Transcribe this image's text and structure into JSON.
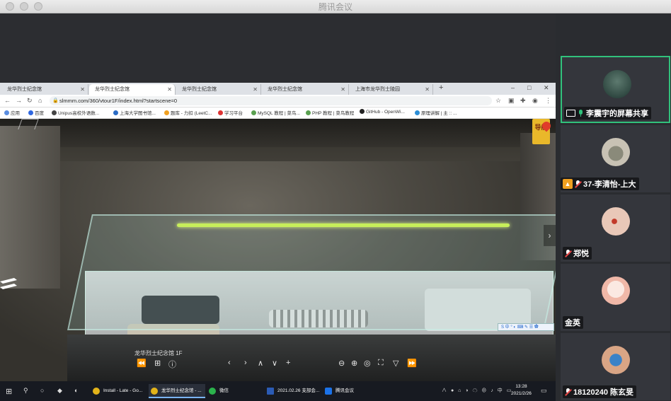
{
  "app": {
    "title": "腾讯会议"
  },
  "browser": {
    "tabs": [
      {
        "label": "龙华烈士纪念馆"
      },
      {
        "label": "龙华烈士纪念馆"
      },
      {
        "label": "龙华烈士纪念馆"
      },
      {
        "label": "龙华烈士纪念馆"
      },
      {
        "label": "上海市龙华烈士陵园"
      }
    ],
    "new_tab": "+",
    "window_controls": {
      "minimize": "–",
      "maximize": "□",
      "close": "✕"
    },
    "url": "slmmm.com/360/vtour1F/index.html?startscene=0",
    "bookmarks": [
      {
        "label": "应用",
        "color": "#5a8de0"
      },
      {
        "label": "百度",
        "color": "#2f67e0"
      },
      {
        "label": "Unipus高校外语数...",
        "color": "#444"
      },
      {
        "label": "上海大学图书馆...",
        "color": "#2a6bc4"
      },
      {
        "label": "题库 - 力扣 (LeetC...",
        "color": "#f0a020"
      },
      {
        "label": "学习平台",
        "color": "#d33"
      },
      {
        "label": "MySQL 教程 | 菜鸟...",
        "color": "#5aa050"
      },
      {
        "label": "PHP 教程 | 菜鸟教程",
        "color": "#5aa050"
      },
      {
        "label": "GitHub - OpenWi...",
        "color": "#222"
      },
      {
        "label": "原理讲解 | 主 :: ...",
        "color": "#2c8ed6"
      }
    ]
  },
  "tour": {
    "scene_name": "龙华烈士纪念馆 1F",
    "guide_label": "导航",
    "ime": "S 中 ° ◐ ⌨ ✎ ☰ ✿",
    "controls": [
      "⏪",
      "⊞",
      "ⓘ",
      "‹",
      "›",
      "∧",
      "∨",
      "+",
      "⊖",
      "⊕",
      "◎",
      "⛶",
      "▽",
      "⏩"
    ]
  },
  "taskbar": {
    "start": "⊞",
    "search": "⚲",
    "apps": [
      {
        "label": "Install - Late - Go...",
        "color": "#e2b31a",
        "active": false
      },
      {
        "label": "龙华烈士纪念馆 - ...",
        "color": "#e2b31a",
        "active": true
      },
      {
        "label": "微信",
        "color": "#2bb24c",
        "active": false
      },
      {
        "label": "2021.02.26 支部会...",
        "color": "#2b5bb5",
        "active": false
      },
      {
        "label": "腾讯会议",
        "color": "#1b72e8",
        "active": false
      }
    ],
    "clock_time": "13:28",
    "clock_date": "2021/2/26",
    "sys_icons": "∧ ● ⌂ ◑ ☁ ⊕ ♪ 中 ▭"
  },
  "participants": [
    {
      "name": "李震宇的屏幕共享",
      "mic": "on",
      "screen_share": true,
      "speaking": true,
      "avatar_color": "#1e3530"
    },
    {
      "name": "37-李清怡-上大",
      "mic": "muted",
      "host": true,
      "speaking": false,
      "avatar_color": "#c8c2b4"
    },
    {
      "name": "郑悦",
      "mic": "muted",
      "speaking": false,
      "avatar_color": "#e9c8b8"
    },
    {
      "name": "金英",
      "mic": "none",
      "speaking": false,
      "avatar_color": "#f6d8cc"
    },
    {
      "name": "18120240 陈玄旻",
      "mic": "muted",
      "speaking": false,
      "avatar_color": "#d9a585"
    }
  ]
}
